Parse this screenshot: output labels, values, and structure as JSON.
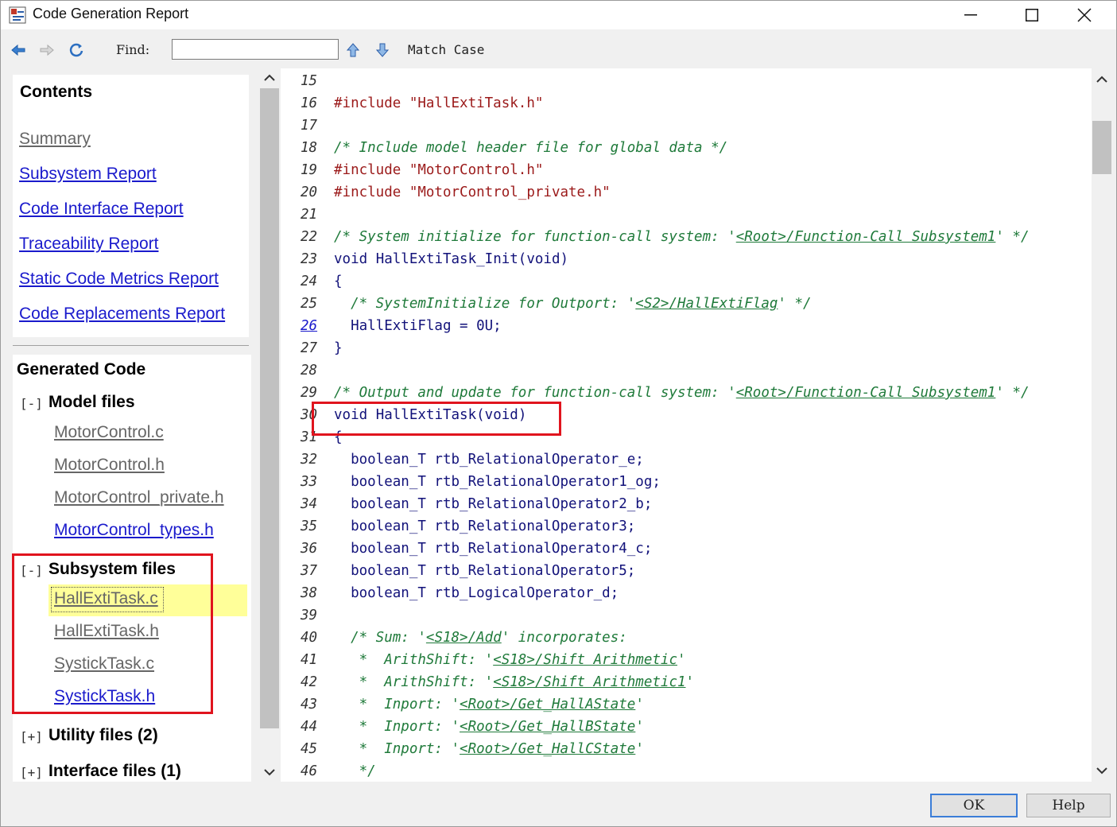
{
  "window": {
    "title": "Code Generation Report"
  },
  "toolbar": {
    "find_label": "Find:",
    "find_value": "",
    "match_case_label": "Match Case"
  },
  "contents": {
    "heading": "Contents",
    "links": [
      {
        "label": "Summary",
        "visited": true
      },
      {
        "label": "Subsystem Report",
        "visited": false
      },
      {
        "label": "Code Interface Report",
        "visited": false
      },
      {
        "label": "Traceability Report",
        "visited": false
      },
      {
        "label": "Static Code Metrics Report",
        "visited": false
      },
      {
        "label": "Code Replacements Report",
        "visited": false
      }
    ]
  },
  "generated_code": {
    "heading": "Generated Code",
    "groups": [
      {
        "toggle": "[-]",
        "label": "Model files",
        "files": [
          "MotorControl.c",
          "MotorControl.h",
          "MotorControl_private.h",
          "MotorControl_types.h"
        ]
      },
      {
        "toggle": "[-]",
        "label": "Subsystem files",
        "files": [
          "HallExtiTask.c",
          "HallExtiTask.h",
          "SystickTask.c",
          "SystickTask.h"
        ]
      },
      {
        "toggle": "[+]",
        "label": "Utility files (2)",
        "files": []
      },
      {
        "toggle": "[+]",
        "label": "Interface files (1)",
        "files": []
      }
    ],
    "selected_file": "HallExtiTask.c"
  },
  "code": {
    "lines": [
      {
        "n": "15",
        "parts": []
      },
      {
        "n": "16",
        "parts": [
          {
            "t": "#include ",
            "c": "pp"
          },
          {
            "t": "\"HallExtiTask.h\"",
            "c": "str"
          }
        ]
      },
      {
        "n": "17",
        "parts": []
      },
      {
        "n": "18",
        "parts": [
          {
            "t": "/* Include model header file for global data */",
            "c": "cm"
          }
        ]
      },
      {
        "n": "19",
        "parts": [
          {
            "t": "#include ",
            "c": "pp"
          },
          {
            "t": "\"MotorControl.h\"",
            "c": "str"
          }
        ]
      },
      {
        "n": "20",
        "parts": [
          {
            "t": "#include ",
            "c": "pp"
          },
          {
            "t": "\"MotorControl_private.h\"",
            "c": "str"
          }
        ]
      },
      {
        "n": "21",
        "parts": []
      },
      {
        "n": "22",
        "parts": [
          {
            "t": "/* System initialize for function-call system: '",
            "c": "cm"
          },
          {
            "t": "<Root>/Function-Call Subsystem1",
            "c": "cm-link"
          },
          {
            "t": "' */",
            "c": "cm"
          }
        ]
      },
      {
        "n": "23",
        "parts": [
          {
            "t": "void",
            "c": "kw"
          },
          {
            "t": " HallExtiTask_Init(",
            "c": "plain"
          },
          {
            "t": "void",
            "c": "kw"
          },
          {
            "t": ")",
            "c": "plain"
          }
        ]
      },
      {
        "n": "24",
        "parts": [
          {
            "t": "{",
            "c": "plain"
          }
        ]
      },
      {
        "n": "25",
        "parts": [
          {
            "t": "  /* SystemInitialize for Outport: '",
            "c": "cm"
          },
          {
            "t": "<S2>/HallExtiFlag",
            "c": "cm-link"
          },
          {
            "t": "' */",
            "c": "cm"
          }
        ]
      },
      {
        "n": "26",
        "link": true,
        "parts": [
          {
            "t": "  HallExtiFlag = 0U;",
            "c": "plain"
          }
        ]
      },
      {
        "n": "27",
        "parts": [
          {
            "t": "}",
            "c": "plain"
          }
        ]
      },
      {
        "n": "28",
        "parts": []
      },
      {
        "n": "29",
        "parts": [
          {
            "t": "/* Output and update for function-call system: '",
            "c": "cm"
          },
          {
            "t": "<Root>/Function-Call Subsystem1",
            "c": "cm-link"
          },
          {
            "t": "' */",
            "c": "cm"
          }
        ]
      },
      {
        "n": "30",
        "parts": [
          {
            "t": "void",
            "c": "kw"
          },
          {
            "t": " HallExtiTask(",
            "c": "plain"
          },
          {
            "t": "void",
            "c": "kw"
          },
          {
            "t": ")",
            "c": "plain"
          }
        ]
      },
      {
        "n": "31",
        "parts": [
          {
            "t": "{",
            "c": "plain"
          }
        ]
      },
      {
        "n": "32",
        "parts": [
          {
            "t": "  boolean_T rtb_RelationalOperator_e;",
            "c": "plain"
          }
        ]
      },
      {
        "n": "33",
        "parts": [
          {
            "t": "  boolean_T rtb_RelationalOperator1_og;",
            "c": "plain"
          }
        ]
      },
      {
        "n": "34",
        "parts": [
          {
            "t": "  boolean_T rtb_RelationalOperator2_b;",
            "c": "plain"
          }
        ]
      },
      {
        "n": "35",
        "parts": [
          {
            "t": "  boolean_T rtb_RelationalOperator3;",
            "c": "plain"
          }
        ]
      },
      {
        "n": "36",
        "parts": [
          {
            "t": "  boolean_T rtb_RelationalOperator4_c;",
            "c": "plain"
          }
        ]
      },
      {
        "n": "37",
        "parts": [
          {
            "t": "  boolean_T rtb_RelationalOperator5;",
            "c": "plain"
          }
        ]
      },
      {
        "n": "38",
        "parts": [
          {
            "t": "  boolean_T rtb_LogicalOperator_d;",
            "c": "plain"
          }
        ]
      },
      {
        "n": "39",
        "parts": []
      },
      {
        "n": "40",
        "parts": [
          {
            "t": "  /* Sum: '",
            "c": "cm"
          },
          {
            "t": "<S18>/Add",
            "c": "cm-link"
          },
          {
            "t": "' incorporates:",
            "c": "cm"
          }
        ]
      },
      {
        "n": "41",
        "parts": [
          {
            "t": "   *  ArithShift: '",
            "c": "cm"
          },
          {
            "t": "<S18>/Shift Arithmetic",
            "c": "cm-link"
          },
          {
            "t": "'",
            "c": "cm"
          }
        ]
      },
      {
        "n": "42",
        "parts": [
          {
            "t": "   *  ArithShift: '",
            "c": "cm"
          },
          {
            "t": "<S18>/Shift Arithmetic1",
            "c": "cm-link"
          },
          {
            "t": "'",
            "c": "cm"
          }
        ]
      },
      {
        "n": "43",
        "parts": [
          {
            "t": "   *  Inport: '",
            "c": "cm"
          },
          {
            "t": "<Root>/Get_HallAState",
            "c": "cm-link"
          },
          {
            "t": "'",
            "c": "cm"
          }
        ]
      },
      {
        "n": "44",
        "parts": [
          {
            "t": "   *  Inport: '",
            "c": "cm"
          },
          {
            "t": "<Root>/Get_HallBState",
            "c": "cm-link"
          },
          {
            "t": "'",
            "c": "cm"
          }
        ]
      },
      {
        "n": "45",
        "parts": [
          {
            "t": "   *  Inport: '",
            "c": "cm"
          },
          {
            "t": "<Root>/Get_HallCState",
            "c": "cm-link"
          },
          {
            "t": "'",
            "c": "cm"
          }
        ]
      },
      {
        "n": "46",
        "parts": [
          {
            "t": "   */",
            "c": "cm"
          }
        ]
      }
    ]
  },
  "buttons": {
    "ok": "OK",
    "help": "Help"
  },
  "colors": {
    "link": "#1a1acc",
    "visited": "#666666",
    "preprocessor": "#9b1a1a",
    "comment": "#1f7a3a",
    "keyword": "#12127a",
    "highlight": "#ffff99",
    "annotation": "#e0141e"
  }
}
